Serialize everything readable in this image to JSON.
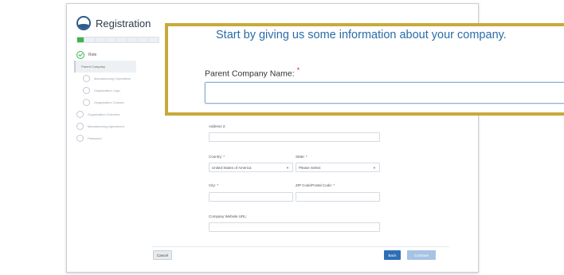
{
  "app": {
    "title": "Registration"
  },
  "sidebar": {
    "steps": [
      {
        "label": "Role",
        "state": "done"
      },
      {
        "label": "Parent Company",
        "state": "current"
      },
      {
        "label": "Manufacturing Operations",
        "state": "sub"
      },
      {
        "label": "Organization Logo",
        "state": "sub"
      },
      {
        "label": "Organization Contact",
        "state": "sub"
      },
      {
        "label": "Organization Overview",
        "state": "todo"
      },
      {
        "label": "Manufacturing Agreement",
        "state": "todo"
      },
      {
        "label": "Password",
        "state": "todo"
      }
    ],
    "progress_fraction": 0.08,
    "progress_segments": 8
  },
  "zoom": {
    "headline": "Start by giving us some information about your company.",
    "label": "Parent Company Name:",
    "required_mark": "*"
  },
  "form": {
    "address2_label": "Address 2:",
    "country_label": "Country:",
    "country_value": "United States of America",
    "state_label": "State:",
    "state_value": "Please Select",
    "city_label": "City:",
    "zip_label": "ZIP Code/Postal Code:",
    "website_label": "Company Website URL:",
    "required_mark": "*"
  },
  "buttons": {
    "cancel": "Cancel",
    "back": "Back",
    "continue": "Continue"
  },
  "colors": {
    "brand_blue": "#2d5c8a",
    "success_green": "#3bb54a",
    "highlight_gold": "#c9a93a",
    "primary_button": "#2d6fb6"
  }
}
